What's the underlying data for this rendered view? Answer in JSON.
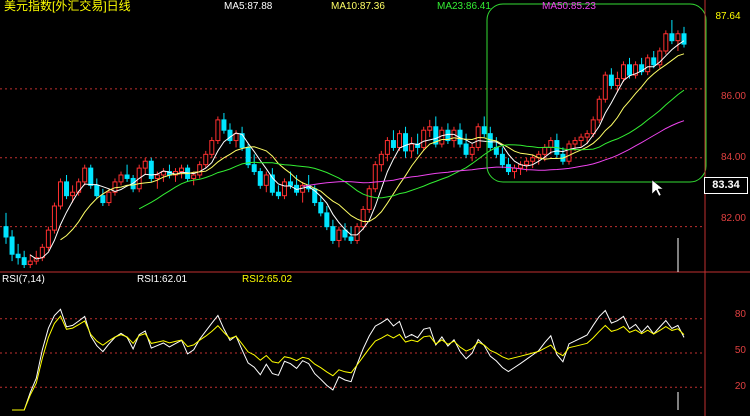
{
  "header": {
    "title": "美元指数[外汇交易]日线",
    "ma5": "MA5:87.88",
    "ma10": "MA10:87.36",
    "ma23": "MA23:86.41",
    "ma50": "MA50:85.23"
  },
  "rsi_header": {
    "label": "RSI(7,14)",
    "rsi1": "RSI1:62.01",
    "rsi2": "RSI2:65.02"
  },
  "price_axis": {
    "labels": [
      "86.00",
      "84.00",
      "82.00"
    ],
    "latest": "87.64",
    "current": "83.34"
  },
  "rsi_axis": {
    "labels": [
      "80",
      "50",
      "20"
    ]
  },
  "colors": {
    "up": "#ff3030",
    "down": "#00e5ff",
    "ma5": "#ffffff",
    "ma10": "#ffff66",
    "ma23": "#33ee33",
    "ma50": "#ee44ee",
    "grid": "#c03030",
    "highlight": "#33dd33"
  },
  "chart_data": {
    "type": "candlestick",
    "title": "美元指数[外汇交易]日线",
    "ylim": [
      80.8,
      88.0
    ],
    "candles": [
      [
        82.0,
        82.4,
        81.5,
        81.7
      ],
      [
        81.7,
        81.9,
        81.0,
        81.2
      ],
      [
        81.2,
        81.5,
        80.9,
        81.1
      ],
      [
        81.1,
        81.3,
        80.8,
        80.9
      ],
      [
        80.9,
        81.2,
        80.8,
        81.0
      ],
      [
        81.0,
        81.3,
        80.9,
        81.1
      ],
      [
        81.1,
        81.5,
        81.0,
        81.4
      ],
      [
        81.4,
        82.0,
        81.3,
        81.9
      ],
      [
        81.9,
        82.7,
        81.8,
        82.6
      ],
      [
        82.6,
        83.4,
        82.5,
        83.3
      ],
      [
        83.3,
        83.5,
        82.8,
        82.9
      ],
      [
        82.9,
        83.2,
        82.7,
        83.0
      ],
      [
        83.0,
        83.4,
        82.9,
        83.3
      ],
      [
        83.3,
        83.8,
        83.2,
        83.7
      ],
      [
        83.7,
        83.8,
        83.1,
        83.2
      ],
      [
        83.2,
        83.4,
        82.8,
        82.9
      ],
      [
        82.9,
        83.1,
        82.6,
        82.7
      ],
      [
        82.7,
        83.1,
        82.6,
        83.0
      ],
      [
        83.0,
        83.4,
        82.9,
        83.3
      ],
      [
        83.3,
        83.6,
        83.2,
        83.5
      ],
      [
        83.5,
        83.8,
        83.3,
        83.4
      ],
      [
        83.4,
        83.5,
        83.0,
        83.1
      ],
      [
        83.1,
        83.8,
        83.0,
        83.7
      ],
      [
        83.7,
        84.0,
        83.5,
        83.9
      ],
      [
        83.9,
        84.0,
        83.3,
        83.4
      ],
      [
        83.4,
        83.6,
        83.1,
        83.5
      ],
      [
        83.5,
        83.7,
        83.3,
        83.6
      ],
      [
        83.6,
        83.8,
        83.4,
        83.5
      ],
      [
        83.5,
        83.7,
        83.3,
        83.6
      ],
      [
        83.6,
        83.8,
        83.4,
        83.7
      ],
      [
        83.7,
        83.8,
        83.3,
        83.4
      ],
      [
        83.4,
        83.6,
        83.2,
        83.5
      ],
      [
        83.5,
        83.9,
        83.4,
        83.8
      ],
      [
        83.8,
        84.2,
        83.7,
        84.1
      ],
      [
        84.1,
        84.6,
        84.0,
        84.5
      ],
      [
        84.5,
        85.2,
        84.4,
        85.1
      ],
      [
        85.1,
        85.3,
        84.7,
        84.8
      ],
      [
        84.8,
        85.0,
        84.4,
        84.5
      ],
      [
        84.5,
        84.8,
        84.3,
        84.7
      ],
      [
        84.7,
        84.9,
        84.2,
        84.3
      ],
      [
        84.3,
        84.4,
        83.7,
        83.8
      ],
      [
        83.8,
        84.1,
        83.5,
        83.6
      ],
      [
        83.6,
        83.7,
        83.1,
        83.2
      ],
      [
        83.2,
        83.6,
        83.0,
        83.5
      ],
      [
        83.5,
        83.7,
        82.9,
        83.0
      ],
      [
        83.0,
        83.2,
        82.8,
        82.9
      ],
      [
        82.9,
        83.4,
        82.8,
        83.3
      ],
      [
        83.3,
        83.6,
        83.1,
        83.2
      ],
      [
        83.2,
        83.5,
        82.9,
        83.0
      ],
      [
        83.0,
        83.3,
        82.7,
        83.2
      ],
      [
        83.2,
        83.5,
        83.0,
        83.1
      ],
      [
        83.1,
        83.2,
        82.6,
        82.7
      ],
      [
        82.7,
        82.9,
        82.3,
        82.4
      ],
      [
        82.4,
        82.6,
        81.9,
        82.0
      ],
      [
        82.0,
        82.2,
        81.5,
        81.6
      ],
      [
        81.6,
        82.0,
        81.4,
        81.9
      ],
      [
        81.9,
        82.1,
        81.6,
        81.7
      ],
      [
        81.7,
        82.0,
        81.5,
        81.6
      ],
      [
        81.6,
        82.1,
        81.5,
        82.0
      ],
      [
        82.0,
        82.6,
        81.9,
        82.5
      ],
      [
        82.5,
        83.2,
        82.4,
        83.1
      ],
      [
        83.1,
        83.9,
        83.0,
        83.8
      ],
      [
        83.8,
        84.2,
        83.6,
        84.1
      ],
      [
        84.1,
        84.6,
        83.9,
        84.5
      ],
      [
        84.5,
        84.8,
        84.2,
        84.3
      ],
      [
        84.3,
        84.8,
        84.2,
        84.7
      ],
      [
        84.7,
        84.9,
        84.0,
        84.2
      ],
      [
        84.2,
        84.6,
        84.0,
        84.4
      ],
      [
        84.4,
        84.7,
        84.1,
        84.3
      ],
      [
        84.3,
        84.9,
        84.2,
        84.8
      ],
      [
        84.8,
        85.1,
        84.6,
        84.9
      ],
      [
        84.9,
        85.2,
        84.3,
        84.4
      ],
      [
        84.4,
        84.9,
        84.3,
        84.8
      ],
      [
        84.8,
        85.0,
        84.4,
        84.5
      ],
      [
        84.5,
        84.9,
        84.3,
        84.8
      ],
      [
        84.8,
        85.0,
        84.3,
        84.4
      ],
      [
        84.4,
        84.7,
        84.0,
        84.1
      ],
      [
        84.1,
        84.4,
        83.9,
        84.3
      ],
      [
        84.3,
        85.0,
        84.2,
        84.9
      ],
      [
        84.9,
        85.2,
        84.6,
        84.7
      ],
      [
        84.7,
        84.9,
        84.2,
        84.3
      ],
      [
        84.3,
        84.6,
        84.0,
        84.1
      ],
      [
        84.1,
        84.3,
        83.7,
        83.8
      ],
      [
        83.8,
        84.0,
        83.5,
        83.6
      ],
      [
        83.6,
        83.8,
        83.4,
        83.7
      ],
      [
        83.7,
        83.9,
        83.5,
        83.8
      ],
      [
        83.8,
        84.0,
        83.6,
        83.9
      ],
      [
        83.9,
        84.1,
        83.7,
        84.0
      ],
      [
        84.0,
        84.2,
        83.8,
        84.1
      ],
      [
        84.1,
        84.4,
        83.9,
        84.3
      ],
      [
        84.3,
        84.6,
        84.1,
        84.5
      ],
      [
        84.5,
        84.7,
        84.0,
        84.1
      ],
      [
        84.1,
        84.3,
        83.8,
        83.9
      ],
      [
        83.9,
        84.5,
        83.8,
        84.4
      ],
      [
        84.4,
        84.6,
        84.2,
        84.5
      ],
      [
        84.5,
        84.7,
        84.3,
        84.6
      ],
      [
        84.6,
        84.8,
        84.4,
        84.7
      ],
      [
        84.7,
        85.2,
        84.6,
        85.1
      ],
      [
        85.1,
        85.8,
        85.0,
        85.7
      ],
      [
        85.7,
        86.5,
        85.6,
        86.4
      ],
      [
        86.4,
        86.6,
        86.0,
        86.1
      ],
      [
        86.1,
        86.5,
        85.9,
        86.3
      ],
      [
        86.3,
        86.8,
        86.2,
        86.7
      ],
      [
        86.7,
        86.9,
        86.3,
        86.4
      ],
      [
        86.4,
        86.8,
        86.3,
        86.7
      ],
      [
        86.7,
        86.9,
        86.4,
        86.5
      ],
      [
        86.5,
        87.0,
        86.4,
        86.9
      ],
      [
        86.9,
        87.1,
        86.6,
        86.7
      ],
      [
        86.7,
        87.2,
        86.6,
        87.1
      ],
      [
        87.1,
        87.7,
        87.0,
        87.6
      ],
      [
        87.6,
        88.0,
        87.3,
        87.4
      ],
      [
        87.4,
        87.7,
        87.1,
        87.6
      ],
      [
        87.6,
        87.8,
        87.2,
        87.3
      ]
    ],
    "rsi_ylim": [
      0,
      100
    ],
    "rsi_ticks": [
      20,
      50,
      80
    ]
  }
}
